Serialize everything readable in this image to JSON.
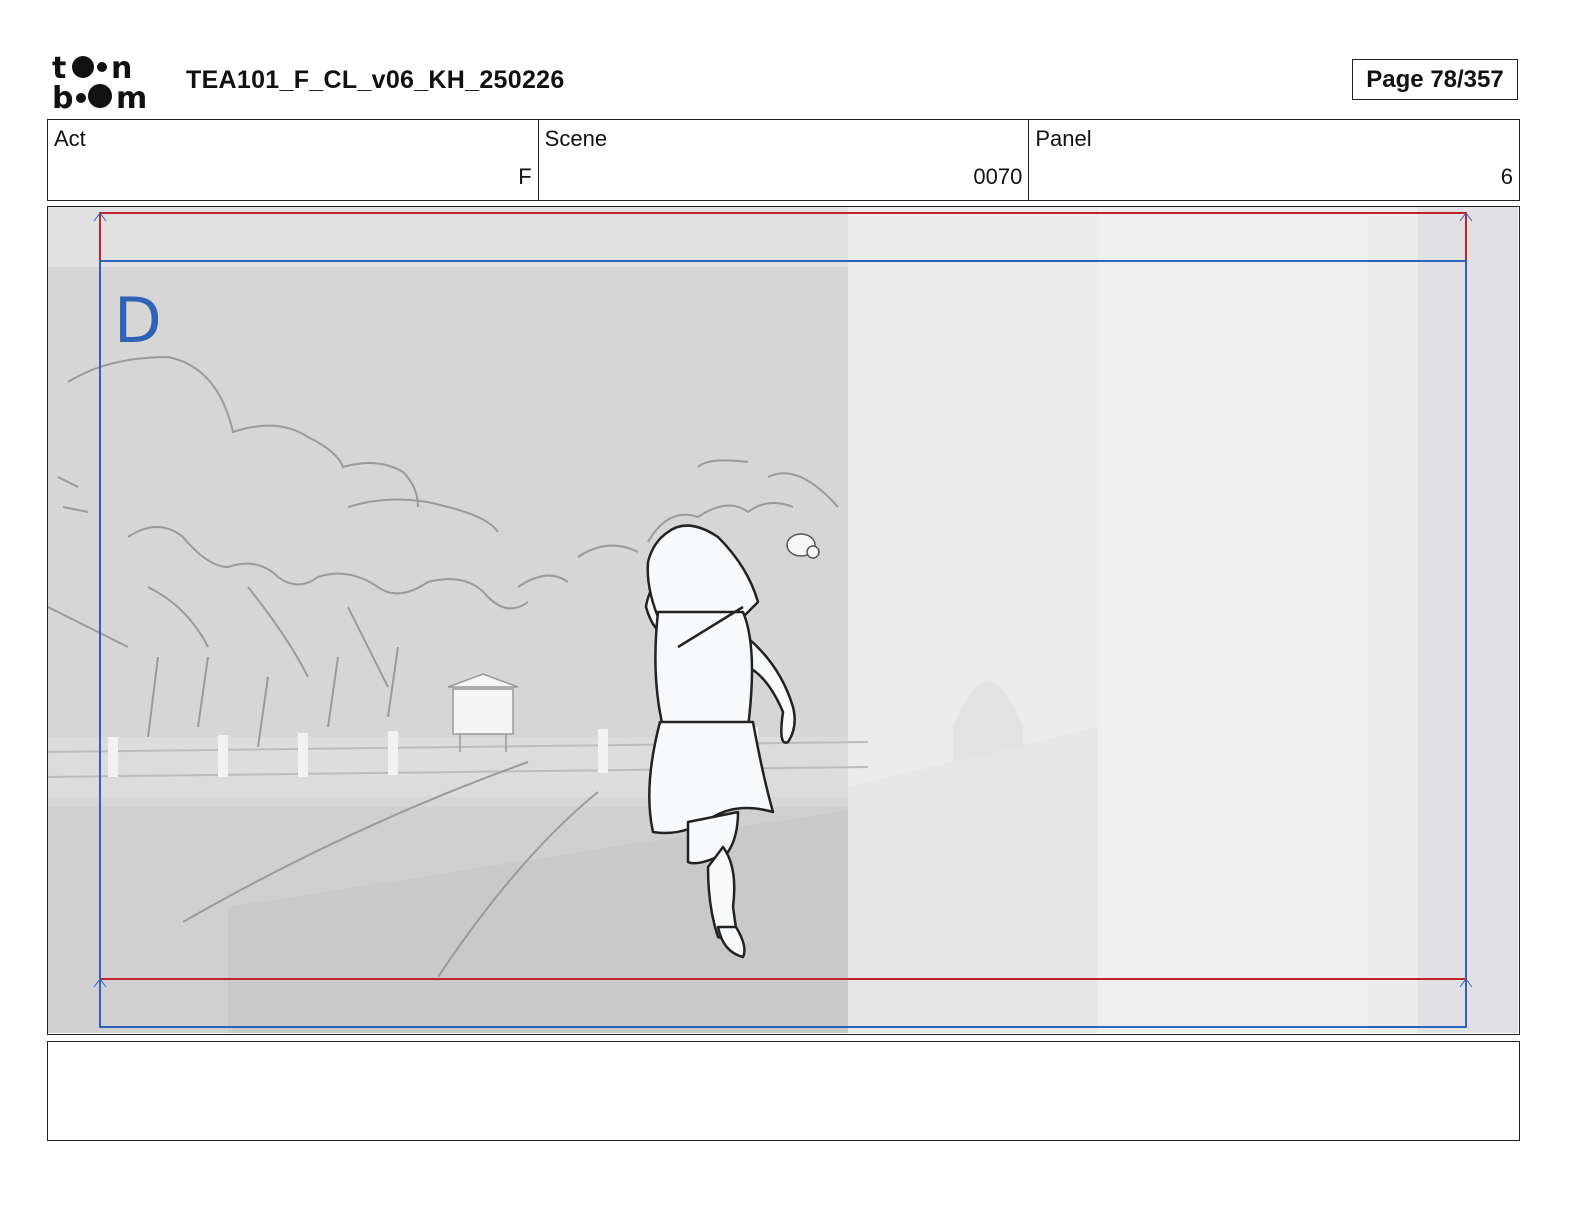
{
  "header": {
    "logo_text": "toonboom",
    "title": "TEA101_F_CL_v06_KH_250226",
    "page_label": "Page 78/357"
  },
  "fields": {
    "act": {
      "label": "Act",
      "value": "F"
    },
    "scene": {
      "label": "Scene",
      "value": "0070"
    },
    "panel": {
      "label": "Panel",
      "value": "6"
    }
  },
  "panel_image": {
    "frame_letter": "D",
    "safe_frame_color": "#c0232c",
    "camera_frame_color": "#2e63b8"
  },
  "caption": {
    "text": ""
  }
}
